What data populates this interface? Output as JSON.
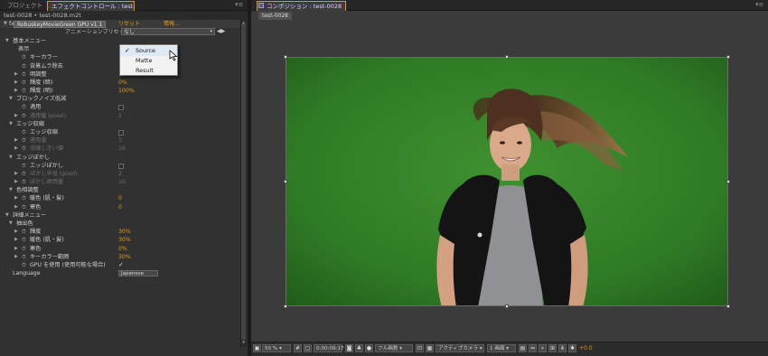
{
  "left_panel": {
    "tabs": [
      "プロジェクト",
      "エフェクトコントロール : test-0028.m2t"
    ],
    "subheader": "test-0028 • test-0028.m2t",
    "effect": {
      "name": "RobuskeyMovieGreen GPU v1.1",
      "reset_label": "リセット",
      "about_label": "情報..."
    },
    "preset": {
      "label": "アニメーションプリセット :",
      "value": "なし"
    }
  },
  "dropdown": {
    "options": [
      "Source",
      "Matte",
      "Result"
    ],
    "selected": "Source"
  },
  "params": [
    {
      "label": "基本メニュー",
      "twirl": "▼",
      "dim": false
    },
    {
      "label": "表示",
      "twirl": "",
      "dim": false
    },
    {
      "label": "キーカラー",
      "twirl": "",
      "dim": false
    },
    {
      "label": "背景ムラ除去",
      "twirl": "",
      "dim": false
    },
    {
      "label": "明調整",
      "twirl": "▶",
      "dim": false
    },
    {
      "label": "輝度 (暗)",
      "twirl": "▶",
      "value": "0%",
      "dim": false
    },
    {
      "label": "輝度 (明)",
      "twirl": "▶",
      "value": "100%",
      "dim": false
    },
    {
      "label": "ブロックノイズ低減",
      "twirl": "▼",
      "dim": false
    },
    {
      "label": "適用",
      "twirl": "",
      "dim": false
    },
    {
      "label": "適用量 (pixel)",
      "twirl": "▶",
      "value": "1",
      "dim": true
    },
    {
      "label": "エッジ収縮",
      "twirl": "▼",
      "dim": false
    },
    {
      "label": "エッジ収縮",
      "twirl": "",
      "dim": false
    },
    {
      "label": "適用量",
      "twirl": "▶",
      "value": "3",
      "dim": true
    },
    {
      "label": "収縮しきい値",
      "twirl": "▶",
      "value": "16",
      "dim": true
    },
    {
      "label": "エッジぼかし",
      "twirl": "▼",
      "dim": false
    },
    {
      "label": "エッジぼかし",
      "twirl": "",
      "dim": false
    },
    {
      "label": "ぼかし半径 (pixel)",
      "twirl": "▶",
      "value": "2",
      "dim": true
    },
    {
      "label": "ぼかし適用量",
      "twirl": "▶",
      "value": "10",
      "dim": true
    },
    {
      "label": "色相調整",
      "twirl": "▼",
      "dim": false
    },
    {
      "label": "暖色 (肌・髪)",
      "twirl": "▶",
      "value": "0",
      "dim": false
    },
    {
      "label": "寒色",
      "twirl": "▶",
      "value": "0",
      "dim": false
    },
    {
      "label": "詳細メニュー",
      "twirl": "▼",
      "dim": false
    },
    {
      "label": "抽出色",
      "twirl": "▼",
      "dim": false
    },
    {
      "label": "輝度",
      "twirl": "▶",
      "value": "30%",
      "dim": false
    },
    {
      "label": "暖色 (肌・髪)",
      "twirl": "▶",
      "value": "30%",
      "dim": false
    },
    {
      "label": "寒色",
      "twirl": "▶",
      "value": "0%",
      "dim": false
    },
    {
      "label": "キーカラー範囲",
      "twirl": "▶",
      "value": "30%",
      "dim": false
    },
    {
      "label": "GPU を使用 (使用可能な場合)",
      "twirl": "",
      "check": "✓",
      "dim": false
    },
    {
      "label": "Language",
      "twirl": "",
      "select": "Japanese",
      "dim": false
    }
  ],
  "composition": {
    "tab_label": "コンポジション : test-0028",
    "subtab": "test-0028"
  },
  "toolbar": {
    "zoom": "50 %",
    "timecode": "0;00;09;17",
    "resolution": "フル画質",
    "camera": "アクティブカメラ",
    "views": "1 画面",
    "exposure": "+0.0"
  },
  "colors": {
    "accent": "#e09a18",
    "green_screen": "#3a8a2c",
    "panel_bg": "#313131"
  }
}
